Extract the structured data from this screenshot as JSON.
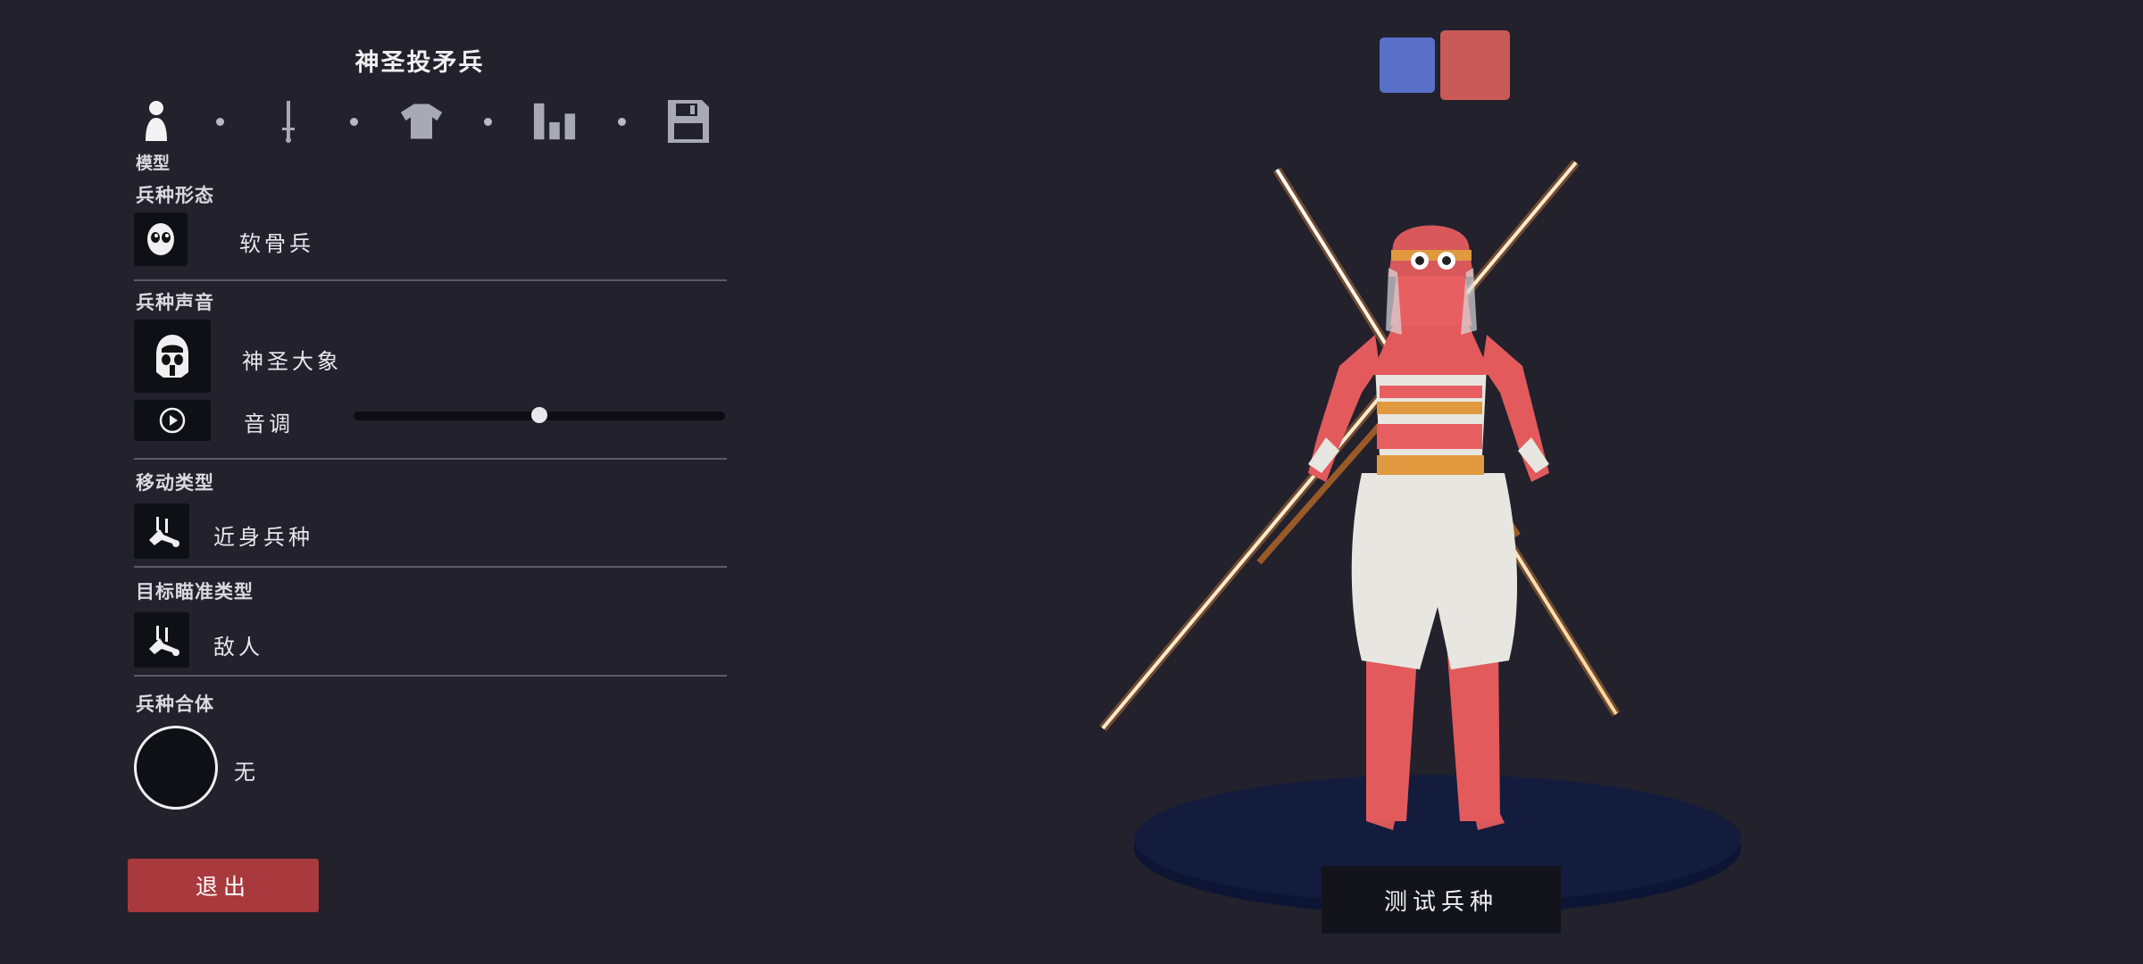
{
  "editor": {
    "unit_name": "神圣投矛兵",
    "tab_caption": "模型",
    "tabs": [
      {
        "icon": "person-icon"
      },
      {
        "icon": "sword-icon"
      },
      {
        "icon": "shirt-icon"
      },
      {
        "icon": "stats-icon"
      },
      {
        "icon": "save-icon"
      }
    ]
  },
  "sections": {
    "form": {
      "label": "兵种形态",
      "value": "软骨兵",
      "icon": "skull-face-icon"
    },
    "voice": {
      "label": "兵种声音",
      "value": "神圣大象",
      "icon": "voice-face-icon",
      "pitch_label": "音调",
      "pitch_value": 0.5
    },
    "movement": {
      "label": "移动类型",
      "value": "近身兵种",
      "icon": "melee-figure-icon"
    },
    "targeting": {
      "label": "目标瞄准类型",
      "value": "敌人",
      "icon": "target-figure-icon"
    },
    "merge": {
      "label": "兵种合体",
      "value": "无"
    }
  },
  "buttons": {
    "exit": "退出",
    "test": "测试兵种"
  },
  "team_colors": {
    "blue": "#5a6fc8",
    "red": "#c95a58"
  },
  "colors": {
    "background": "#22212c",
    "exit_button": "#a8393c"
  }
}
